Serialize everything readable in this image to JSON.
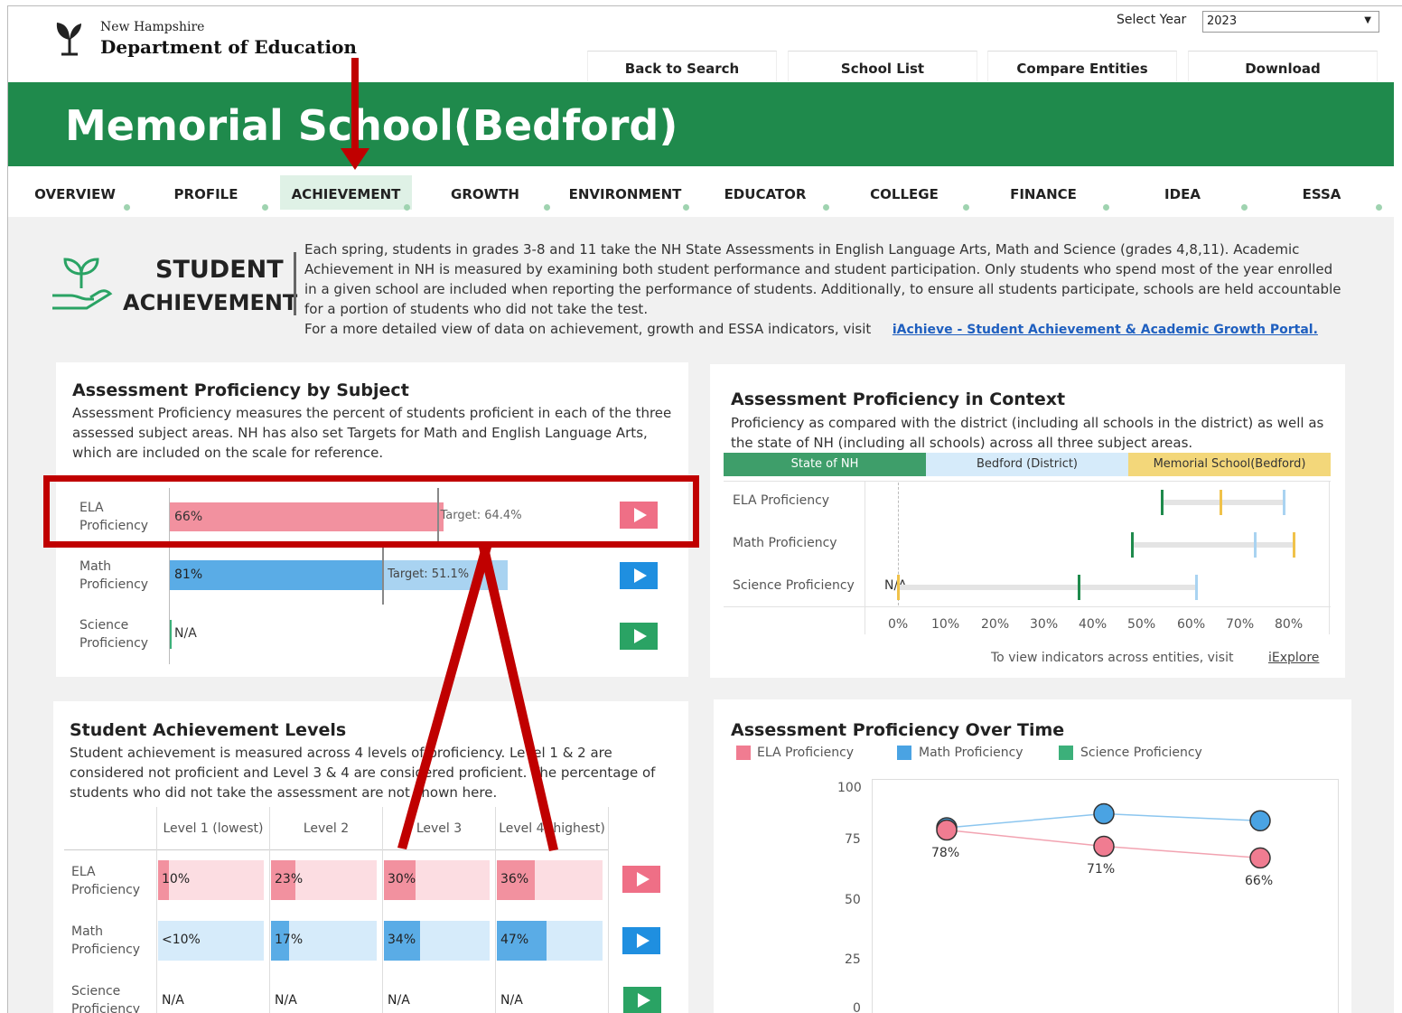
{
  "header": {
    "org_small": "New Hampshire",
    "org_big": "Department of Education",
    "year_label": "Select Year",
    "year_value": "2023",
    "nav": [
      "Back to Search",
      "School List",
      "Compare Entities",
      "Download"
    ]
  },
  "banner": {
    "title": "Memorial School(Bedford)"
  },
  "tabs": [
    "OVERVIEW",
    "PROFILE",
    "ACHIEVEMENT",
    "GROWTH",
    "ENVIRONMENT",
    "EDUCATOR",
    "COLLEGE",
    "FINANCE",
    "IDEA",
    "ESSA"
  ],
  "active_tab": "ACHIEVEMENT",
  "intro": {
    "title_line1": "STUDENT",
    "title_line2": "ACHIEVEMENT",
    "text": "Each spring, students in grades 3-8 and 11 take the NH State Assessments in English Language Arts, Math and Science (grades 4,8,11). Academic Achievement in NH is measured by examining both student performance and student participation. Only students who spend most of the year enrolled in a given school are included when reporting the performance of students. Additionally, to ensure all students participate, schools are held accountable for a portion of students who did not take the test.",
    "link_prefix": "For a more detailed view of data on achievement, growth and ESSA indicators, visit",
    "link_text": "iAchieve - Student Achievement & Academic Growth Portal."
  },
  "proficiency_by_subject": {
    "title": "Assessment Proficiency by Subject",
    "desc": "Assessment Proficiency measures the percent of students proficient in each of the three assessed subject areas. NH has also set Targets for Math and English Language Arts, which are included on the scale for reference.",
    "rows": [
      {
        "line1": "ELA",
        "line2": "Proficiency",
        "value_label": "66%",
        "value": 66,
        "target_label": "Target: 64.4%",
        "target": 64.4,
        "color": "#f2919f"
      },
      {
        "line1": "Math",
        "line2": "Proficiency",
        "value_label": "81%",
        "value": 81,
        "target_label": "Target: 51.1%",
        "target": 51.1,
        "color": "#5aace6"
      },
      {
        "line1": "Science",
        "line2": "Proficiency",
        "value_label": "N/A",
        "value": null,
        "target_label": "",
        "target": null,
        "color": "#3cb07a"
      }
    ]
  },
  "proficiency_context": {
    "title": "Assessment Proficiency in Context",
    "desc": "Proficiency as compared with the district (including all schools in the district) as well as the state of NH (including all schools) across all three subject areas.",
    "legend": [
      {
        "label": "State of NH",
        "bg": "#3e9e6a",
        "fg": "#ffffff"
      },
      {
        "label": "Bedford (District)",
        "bg": "#d6ebfa",
        "fg": "#333333"
      },
      {
        "label": "Memorial School(Bedford)",
        "bg": "#f3d77a",
        "fg": "#333333"
      }
    ],
    "rows": [
      "ELA Proficiency",
      "Math Proficiency",
      "Science Proficiency"
    ],
    "na_label": "N/A",
    "ticks": [
      "0%",
      "10%",
      "20%",
      "30%",
      "40%",
      "50%",
      "60%",
      "70%",
      "80%"
    ],
    "footer_text": "To view indicators across entities, visit",
    "footer_link": "iExplore"
  },
  "achievement_levels": {
    "title": "Student Achievement Levels",
    "desc": "Student achievement is measured across 4 levels of proficiency. Level 1 & 2 are considered not proficient and Level 3 & 4 are considered proficient. The percentage of students who did not take the assessment are not shown here.",
    "headers": [
      "Level 1 (lowest)",
      "Level 2",
      "Level 3",
      "Level 4 (highest)"
    ],
    "rows": [
      {
        "line1": "ELA",
        "line2": "Proficiency",
        "cells": [
          "10%",
          "23%",
          "30%",
          "36%"
        ]
      },
      {
        "line1": "Math",
        "line2": "Proficiency",
        "cells": [
          "<10%",
          "17%",
          "34%",
          "47%"
        ]
      },
      {
        "line1": "Science",
        "line2": "Proficiency",
        "cells": [
          "N/A",
          "N/A",
          "N/A",
          "N/A"
        ]
      }
    ]
  },
  "over_time": {
    "title": "Assessment Proficiency Over Time",
    "legend": [
      "ELA Proficiency",
      "Math Proficiency",
      "Science Proficiency"
    ],
    "legend_colors": [
      "#f07c91",
      "#4aa3e3",
      "#3cb07a"
    ],
    "yticks": [
      "100",
      "75",
      "50",
      "25",
      "0"
    ],
    "ela_labels": [
      "78%",
      "71%",
      "66%"
    ]
  },
  "chart_data": [
    {
      "type": "bar",
      "title": "Assessment Proficiency by Subject",
      "categories": [
        "ELA Proficiency",
        "Math Proficiency",
        "Science Proficiency"
      ],
      "values": [
        66,
        81,
        null
      ],
      "targets": [
        64.4,
        51.1,
        null
      ]
    },
    {
      "type": "scatter",
      "title": "Assessment Proficiency in Context",
      "categories": [
        "ELA Proficiency",
        "Math Proficiency",
        "Science Proficiency"
      ],
      "series": [
        {
          "name": "State of NH",
          "values": [
            54,
            48,
            37
          ]
        },
        {
          "name": "Bedford (District)",
          "values": [
            79,
            73,
            61
          ]
        },
        {
          "name": "Memorial School(Bedford)",
          "values": [
            66,
            81,
            null
          ]
        }
      ],
      "xlim": [
        0,
        80
      ]
    },
    {
      "type": "bar",
      "title": "Student Achievement Levels",
      "categories": [
        "Level 1 (lowest)",
        "Level 2",
        "Level 3",
        "Level 4 (highest)"
      ],
      "series": [
        {
          "name": "ELA Proficiency",
          "values": [
            10,
            23,
            30,
            36
          ]
        },
        {
          "name": "Math Proficiency",
          "values": [
            null,
            17,
            34,
            47
          ]
        },
        {
          "name": "Science Proficiency",
          "values": [
            null,
            null,
            null,
            null
          ]
        }
      ]
    },
    {
      "type": "line",
      "title": "Assessment Proficiency Over Time",
      "x": [
        1,
        2,
        3
      ],
      "series": [
        {
          "name": "ELA Proficiency",
          "values": [
            78,
            71,
            66
          ]
        },
        {
          "name": "Math Proficiency",
          "values": [
            79,
            85,
            82
          ]
        }
      ],
      "ylim": [
        0,
        100
      ]
    }
  ]
}
